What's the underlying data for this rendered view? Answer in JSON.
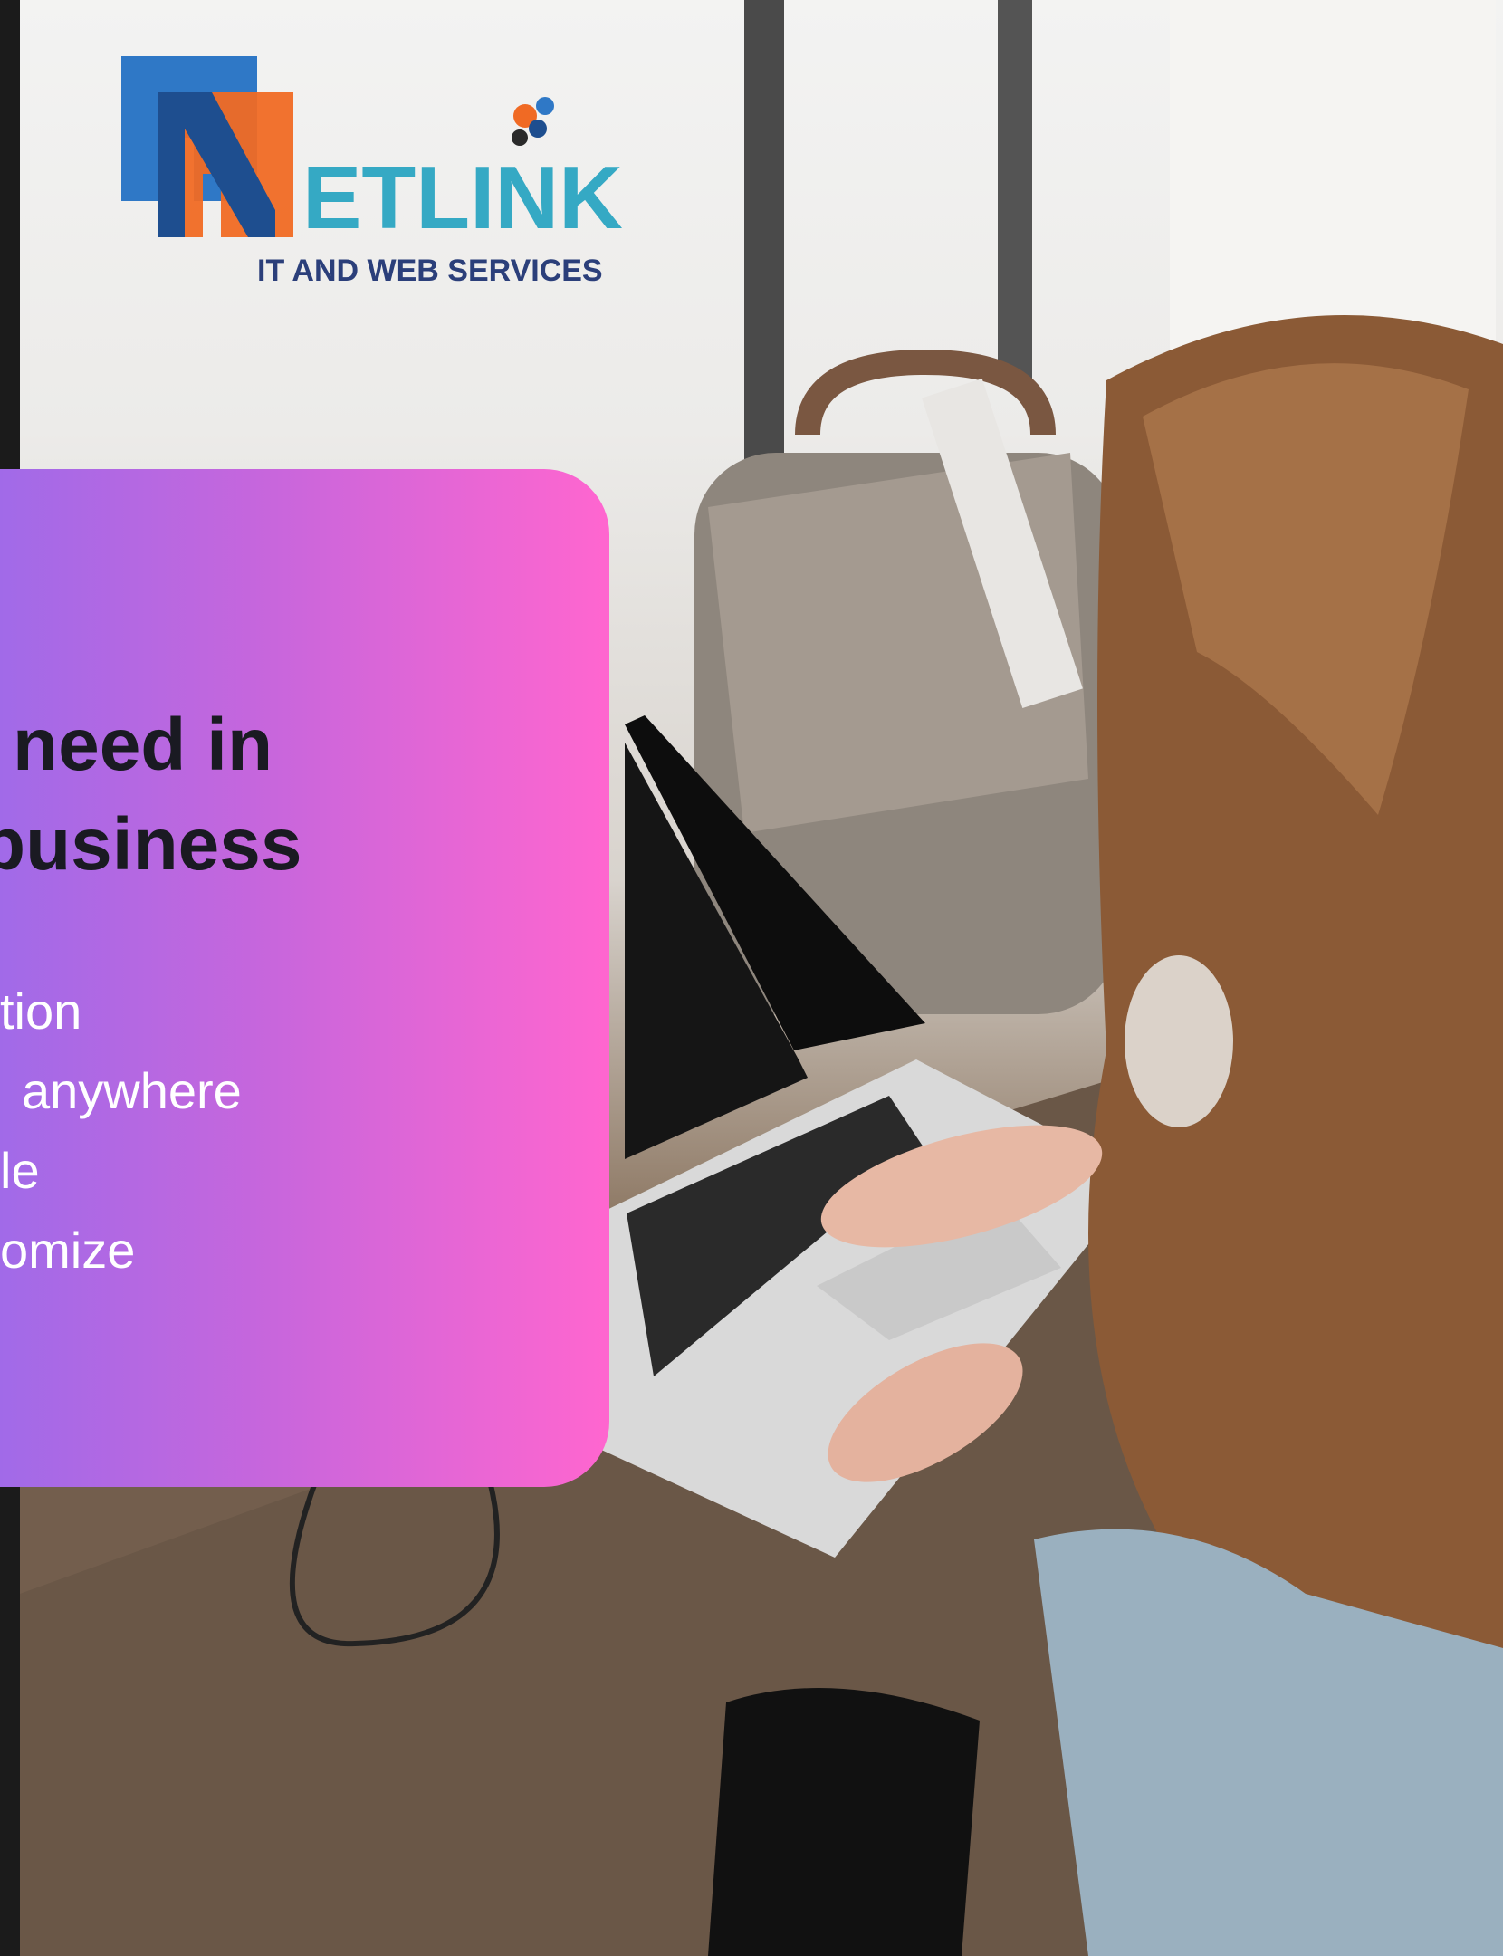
{
  "brand": {
    "logo_letter": "N",
    "logo_name": "ETLINK",
    "logo_tagline": "IT AND WEB SERVICES"
  },
  "promo": {
    "headline_lines": [
      "need in",
      "business"
    ],
    "features": [
      "tion",
      "anywhere",
      "le",
      "omize"
    ]
  },
  "colors": {
    "card_gradient_start": "#a16ae8",
    "card_gradient_end": "#ff66cf",
    "headline": "#1a1a22",
    "feature_text": "#ffffff",
    "logo_blue": "#2f78c6",
    "logo_orange": "#f06a24",
    "logo_teal": "#35a9c4"
  },
  "background_photo": {
    "icons": [
      "woman-icon",
      "laptop-icon",
      "backpack-icon",
      "window-icon",
      "desk-icon"
    ]
  }
}
